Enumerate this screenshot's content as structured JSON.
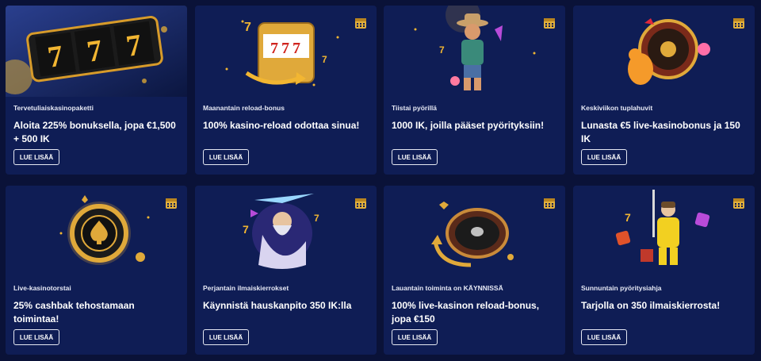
{
  "promotions": [
    {
      "tag": "Tervetuliaiskasinopaketti",
      "title": "Aloita 225% bonuksella, jopa €1,500 + 500 IK",
      "button": "LUE LISÄÄ"
    },
    {
      "tag": "Maanantain reload-bonus",
      "title": "100% kasino-reload odottaa sinua!",
      "button": "LUE LISÄÄ"
    },
    {
      "tag": "Tiistai pyörillä",
      "title": "1000 IK, joilla pääset pyörityksiin!",
      "button": "LUE LISÄÄ"
    },
    {
      "tag": "Keskiviikon tuplahuvit",
      "title": "Lunasta €5 live-kasinobonus ja 150 IK",
      "button": "LUE LISÄÄ"
    },
    {
      "tag": "Live-kasinotorstai",
      "title": "25% cashbak tehostamaan toimintaa!",
      "button": "LUE LISÄÄ"
    },
    {
      "tag": "Perjantain ilmaiskierrokset",
      "title": "Käynnistä hauskanpito 350 IK:lla",
      "button": "LUE LISÄÄ"
    },
    {
      "tag": "Lauantain toiminta on KÄYNNISSÄ",
      "title": "100% live-kasinon reload-bonus, jopa €150",
      "button": "LUE LISÄÄ"
    },
    {
      "tag": "Sunnuntain pyöritysiahja",
      "title": "Tarjolla on 350 ilmaiskierrosta!",
      "button": "LUE LISÄÄ"
    }
  ],
  "icons": {
    "calendar": "calendar-icon",
    "slot_machine": "slot-machine-icon",
    "cowboy": "cowboy-character-icon",
    "roulette": "roulette-wheel-icon",
    "poker_chip": "poker-chip-icon",
    "zeus": "zeus-character-icon",
    "miner": "miner-character-icon"
  },
  "colors": {
    "page_bg": "#0a1238",
    "card_bg": "#0f1d55",
    "gold": "#f2b632",
    "button_border": "#e5e8f3"
  }
}
